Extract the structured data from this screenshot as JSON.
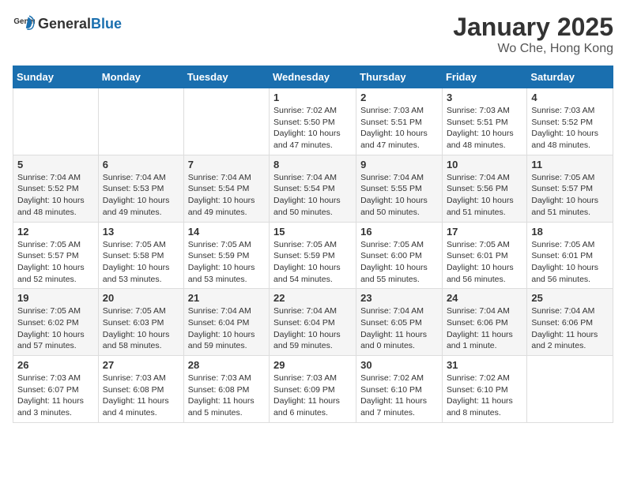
{
  "header": {
    "logo_general": "General",
    "logo_blue": "Blue",
    "title": "January 2025",
    "subtitle": "Wo Che, Hong Kong"
  },
  "weekdays": [
    "Sunday",
    "Monday",
    "Tuesday",
    "Wednesday",
    "Thursday",
    "Friday",
    "Saturday"
  ],
  "weeks": [
    {
      "days": [
        {
          "num": "",
          "info": ""
        },
        {
          "num": "",
          "info": ""
        },
        {
          "num": "",
          "info": ""
        },
        {
          "num": "1",
          "info": "Sunrise: 7:02 AM\nSunset: 5:50 PM\nDaylight: 10 hours\nand 47 minutes."
        },
        {
          "num": "2",
          "info": "Sunrise: 7:03 AM\nSunset: 5:51 PM\nDaylight: 10 hours\nand 47 minutes."
        },
        {
          "num": "3",
          "info": "Sunrise: 7:03 AM\nSunset: 5:51 PM\nDaylight: 10 hours\nand 48 minutes."
        },
        {
          "num": "4",
          "info": "Sunrise: 7:03 AM\nSunset: 5:52 PM\nDaylight: 10 hours\nand 48 minutes."
        }
      ]
    },
    {
      "days": [
        {
          "num": "5",
          "info": "Sunrise: 7:04 AM\nSunset: 5:52 PM\nDaylight: 10 hours\nand 48 minutes."
        },
        {
          "num": "6",
          "info": "Sunrise: 7:04 AM\nSunset: 5:53 PM\nDaylight: 10 hours\nand 49 minutes."
        },
        {
          "num": "7",
          "info": "Sunrise: 7:04 AM\nSunset: 5:54 PM\nDaylight: 10 hours\nand 49 minutes."
        },
        {
          "num": "8",
          "info": "Sunrise: 7:04 AM\nSunset: 5:54 PM\nDaylight: 10 hours\nand 50 minutes."
        },
        {
          "num": "9",
          "info": "Sunrise: 7:04 AM\nSunset: 5:55 PM\nDaylight: 10 hours\nand 50 minutes."
        },
        {
          "num": "10",
          "info": "Sunrise: 7:04 AM\nSunset: 5:56 PM\nDaylight: 10 hours\nand 51 minutes."
        },
        {
          "num": "11",
          "info": "Sunrise: 7:05 AM\nSunset: 5:57 PM\nDaylight: 10 hours\nand 51 minutes."
        }
      ]
    },
    {
      "days": [
        {
          "num": "12",
          "info": "Sunrise: 7:05 AM\nSunset: 5:57 PM\nDaylight: 10 hours\nand 52 minutes."
        },
        {
          "num": "13",
          "info": "Sunrise: 7:05 AM\nSunset: 5:58 PM\nDaylight: 10 hours\nand 53 minutes."
        },
        {
          "num": "14",
          "info": "Sunrise: 7:05 AM\nSunset: 5:59 PM\nDaylight: 10 hours\nand 53 minutes."
        },
        {
          "num": "15",
          "info": "Sunrise: 7:05 AM\nSunset: 5:59 PM\nDaylight: 10 hours\nand 54 minutes."
        },
        {
          "num": "16",
          "info": "Sunrise: 7:05 AM\nSunset: 6:00 PM\nDaylight: 10 hours\nand 55 minutes."
        },
        {
          "num": "17",
          "info": "Sunrise: 7:05 AM\nSunset: 6:01 PM\nDaylight: 10 hours\nand 56 minutes."
        },
        {
          "num": "18",
          "info": "Sunrise: 7:05 AM\nSunset: 6:01 PM\nDaylight: 10 hours\nand 56 minutes."
        }
      ]
    },
    {
      "days": [
        {
          "num": "19",
          "info": "Sunrise: 7:05 AM\nSunset: 6:02 PM\nDaylight: 10 hours\nand 57 minutes."
        },
        {
          "num": "20",
          "info": "Sunrise: 7:05 AM\nSunset: 6:03 PM\nDaylight: 10 hours\nand 58 minutes."
        },
        {
          "num": "21",
          "info": "Sunrise: 7:04 AM\nSunset: 6:04 PM\nDaylight: 10 hours\nand 59 minutes."
        },
        {
          "num": "22",
          "info": "Sunrise: 7:04 AM\nSunset: 6:04 PM\nDaylight: 10 hours\nand 59 minutes."
        },
        {
          "num": "23",
          "info": "Sunrise: 7:04 AM\nSunset: 6:05 PM\nDaylight: 11 hours\nand 0 minutes."
        },
        {
          "num": "24",
          "info": "Sunrise: 7:04 AM\nSunset: 6:06 PM\nDaylight: 11 hours\nand 1 minute."
        },
        {
          "num": "25",
          "info": "Sunrise: 7:04 AM\nSunset: 6:06 PM\nDaylight: 11 hours\nand 2 minutes."
        }
      ]
    },
    {
      "days": [
        {
          "num": "26",
          "info": "Sunrise: 7:03 AM\nSunset: 6:07 PM\nDaylight: 11 hours\nand 3 minutes."
        },
        {
          "num": "27",
          "info": "Sunrise: 7:03 AM\nSunset: 6:08 PM\nDaylight: 11 hours\nand 4 minutes."
        },
        {
          "num": "28",
          "info": "Sunrise: 7:03 AM\nSunset: 6:08 PM\nDaylight: 11 hours\nand 5 minutes."
        },
        {
          "num": "29",
          "info": "Sunrise: 7:03 AM\nSunset: 6:09 PM\nDaylight: 11 hours\nand 6 minutes."
        },
        {
          "num": "30",
          "info": "Sunrise: 7:02 AM\nSunset: 6:10 PM\nDaylight: 11 hours\nand 7 minutes."
        },
        {
          "num": "31",
          "info": "Sunrise: 7:02 AM\nSunset: 6:10 PM\nDaylight: 11 hours\nand 8 minutes."
        },
        {
          "num": "",
          "info": ""
        }
      ]
    }
  ]
}
